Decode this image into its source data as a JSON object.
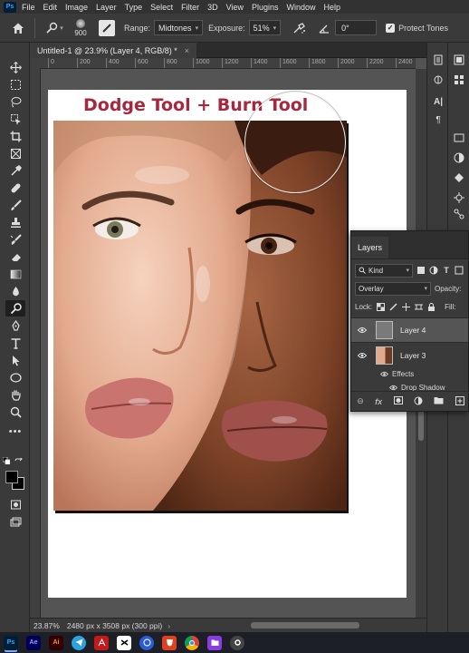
{
  "menubar": {
    "logo": "Ps",
    "items": [
      "File",
      "Edit",
      "Image",
      "Layer",
      "Type",
      "Select",
      "Filter",
      "3D",
      "View",
      "Plugins",
      "Window",
      "Help"
    ]
  },
  "options": {
    "brush_size": "900",
    "range_label": "Range:",
    "range_value": "Midtones",
    "exposure_label": "Exposure:",
    "exposure_value": "51%",
    "angle_value": "0°",
    "protect_tones_label": "Protect Tones"
  },
  "document": {
    "tab_title": "Untitled-1 @ 23.9% (Layer 4, RGB/8) *",
    "title_text": "Dodge Tool + Burn Tool"
  },
  "ruler": {
    "ticks": [
      "0",
      "200",
      "400",
      "600",
      "800",
      "1000",
      "1200",
      "1400",
      "1600",
      "1800",
      "2000",
      "2200",
      "2400"
    ]
  },
  "layers_panel": {
    "tab_label": "Layers",
    "filter_value": "Kind",
    "blend_mode": "Overlay",
    "opacity_label": "Opacity:",
    "lock_label": "Lock:",
    "fill_label": "Fill:",
    "layers": [
      {
        "name": "Layer 4",
        "selected": true
      },
      {
        "name": "Layer 3",
        "selected": false
      }
    ],
    "effects_label": "Effects",
    "effect_name": "Drop Shadow",
    "footer_fx": "fx"
  },
  "status": {
    "zoom": "23.87%",
    "doc_info": "2480 px x 3508 px (300 ppi)"
  },
  "taskbar": {
    "apps": [
      {
        "label": "Ps",
        "color": "#001e36",
        "text_color": "#31a8ff"
      },
      {
        "label": "Ae",
        "color": "#00005b",
        "text_color": "#9999ff"
      },
      {
        "label": "Ai",
        "color": "#330000",
        "text_color": "#ff9a00"
      },
      {
        "label": "",
        "color": "#2aa3e0",
        "text_color": "#fff"
      },
      {
        "label": "",
        "color": "#c21a1a",
        "text_color": "#fff"
      },
      {
        "label": "",
        "color": "#ffffff",
        "text_color": "#000"
      },
      {
        "label": "",
        "color": "#2b5cd6",
        "text_color": "#fff"
      },
      {
        "label": "",
        "color": "#e0401c",
        "text_color": "#fff"
      },
      {
        "label": "",
        "color": "#3fa34d",
        "text_color": "#fff"
      },
      {
        "label": "",
        "color": "#8a3be2",
        "text_color": "#fff"
      },
      {
        "label": "",
        "color": "#444444",
        "text_color": "#fff"
      }
    ]
  }
}
